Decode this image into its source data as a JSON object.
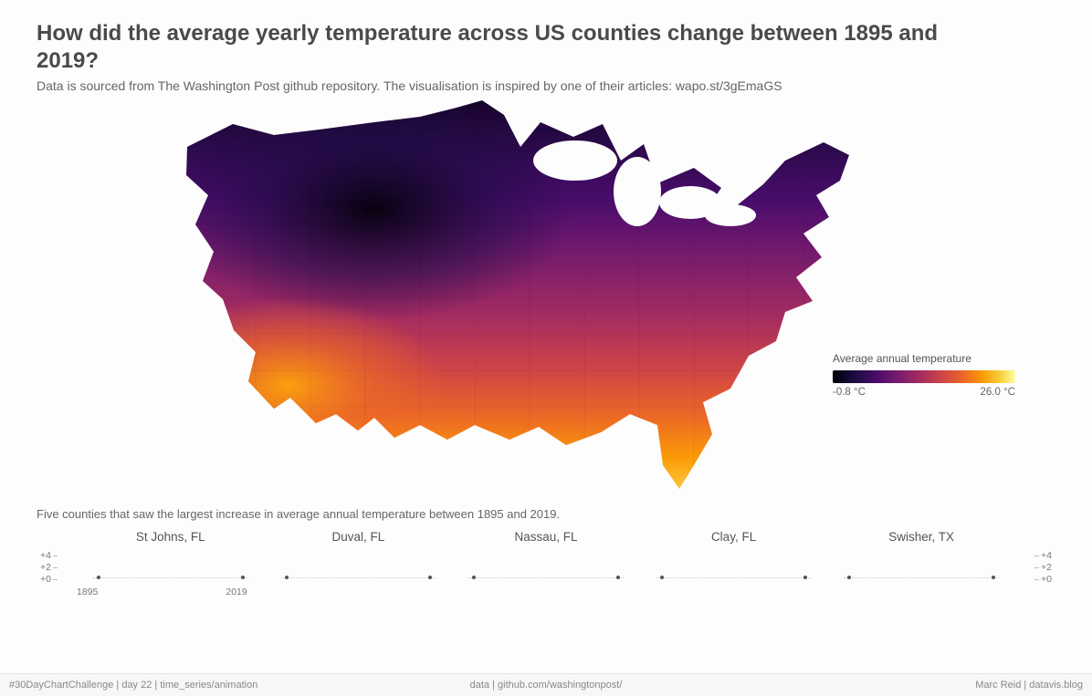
{
  "title": "How did the average yearly temperature across US counties change between 1895 and 2019?",
  "subtitle": "Data is sourced from The Washington Post github repository. The visualisation is inspired by one of their articles: wapo.st/3gEmaGS",
  "legend": {
    "title": "Average annual temperature",
    "min_label": "-0.8 °C",
    "max_label": "26.0 °C"
  },
  "small_multiples": {
    "caption": "Five counties that saw the largest increase in average annual temperature between 1895 and 2019.",
    "y_ticks": [
      "+4",
      "+2",
      "+0"
    ],
    "x_ticks": [
      "1895",
      "2019"
    ],
    "panels": [
      {
        "name": "St Johns, FL"
      },
      {
        "name": "Duval, FL"
      },
      {
        "name": "Nassau, FL"
      },
      {
        "name": "Clay, FL"
      },
      {
        "name": "Swisher, TX"
      }
    ]
  },
  "footer": {
    "left": "#30DayChartChallenge | day 22 | time_series/animation",
    "center": "data | github.com/washingtonpost/",
    "right": "Marc Reid | datavis.blog"
  },
  "chart_data": {
    "type": "choropleth-map",
    "geography": "US counties (contiguous US)",
    "variable": "Average annual temperature (°C)",
    "color_scale": "inferno",
    "color_domain": [
      -0.8,
      26.0
    ],
    "note": "Per-county numeric values are encoded by color on the map and are not individually labeled; exact county values cannot be read from the image.",
    "small_multiples": {
      "metric": "Change in average annual temperature vs baseline (°C)",
      "x_range": [
        1895,
        2019
      ],
      "y_range": [
        0,
        4
      ],
      "series": [
        {
          "county": "St Johns, FL"
        },
        {
          "county": "Duval, FL"
        },
        {
          "county": "Nassau, FL"
        },
        {
          "county": "Clay, FL"
        },
        {
          "county": "Swisher, TX"
        }
      ]
    }
  }
}
